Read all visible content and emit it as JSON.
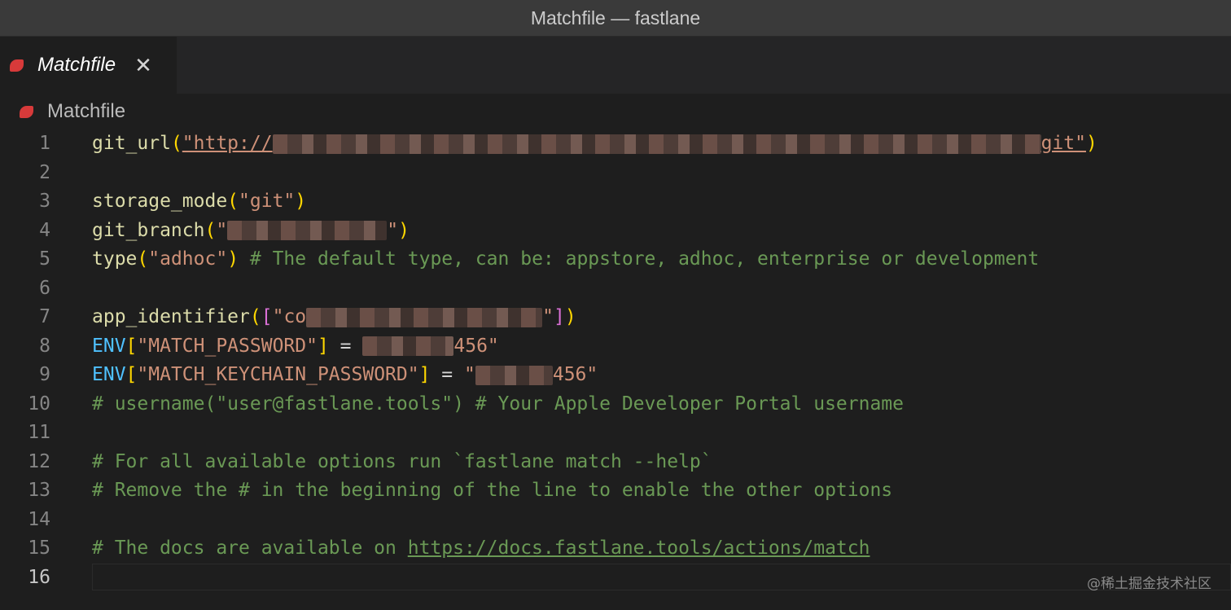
{
  "window": {
    "title": "Matchfile — fastlane"
  },
  "tab": {
    "label": "Matchfile",
    "close_glyph": "✕",
    "icon": "ruby-icon"
  },
  "breadcrumb": {
    "label": "Matchfile",
    "icon": "ruby-icon"
  },
  "editor": {
    "active_line": 16,
    "line_numbers": [
      "1",
      "2",
      "3",
      "4",
      "5",
      "6",
      "7",
      "8",
      "9",
      "10",
      "11",
      "12",
      "13",
      "14",
      "15",
      "16"
    ],
    "lines": {
      "l1": {
        "fn": "git_url",
        "open": "(",
        "str_start": "\"http://",
        "str_end": "git\"",
        "close": ")"
      },
      "l3": {
        "fn": "storage_mode",
        "open": "(",
        "str": "\"git\"",
        "close": ")"
      },
      "l4": {
        "fn": "git_branch",
        "open": "(",
        "str_start": "\"",
        "str_end": "\"",
        "close": ")"
      },
      "l5": {
        "fn": "type",
        "open": "(",
        "str": "\"adhoc\"",
        "close": ")",
        "comment": " # The default type, can be: appstore, adhoc, enterprise or development"
      },
      "l7": {
        "fn": "app_identifier",
        "open": "(",
        "bracket_open": "[",
        "str_start": "\"co",
        "str_end": "\"",
        "bracket_close": "]",
        "close": ")"
      },
      "l8": {
        "const": "ENV",
        "bracket_open": "[",
        "key": "\"MATCH_PASSWORD\"",
        "bracket_close": "]",
        "eq": " = ",
        "str_start": "",
        "str_end": "456\""
      },
      "l9": {
        "const": "ENV",
        "bracket_open": "[",
        "key": "\"MATCH_KEYCHAIN_PASSWORD\"",
        "bracket_close": "]",
        "eq": " = ",
        "str_start": "\"",
        "str_end": "456\""
      },
      "l10": {
        "comment": "# username(\"user@fastlane.tools\") # Your Apple Developer Portal username"
      },
      "l12": {
        "comment": "# For all available options run `fastlane match --help`"
      },
      "l13": {
        "comment": "# Remove the # in the beginning of the line to enable the other options"
      },
      "l15": {
        "comment_prefix": "# The docs are available on ",
        "link": "https://docs.fastlane.tools/actions/match"
      }
    }
  },
  "watermark": {
    "text": "@稀土掘金技术社区"
  },
  "colors": {
    "background": "#1e1e1e",
    "function": "#dcdcaa",
    "string": "#ce9178",
    "comment": "#6a9955",
    "constant": "#4fc1ff",
    "paren": "#ffd700",
    "bracket": "#da70d6",
    "ruby_icon": "#d73a3a"
  }
}
